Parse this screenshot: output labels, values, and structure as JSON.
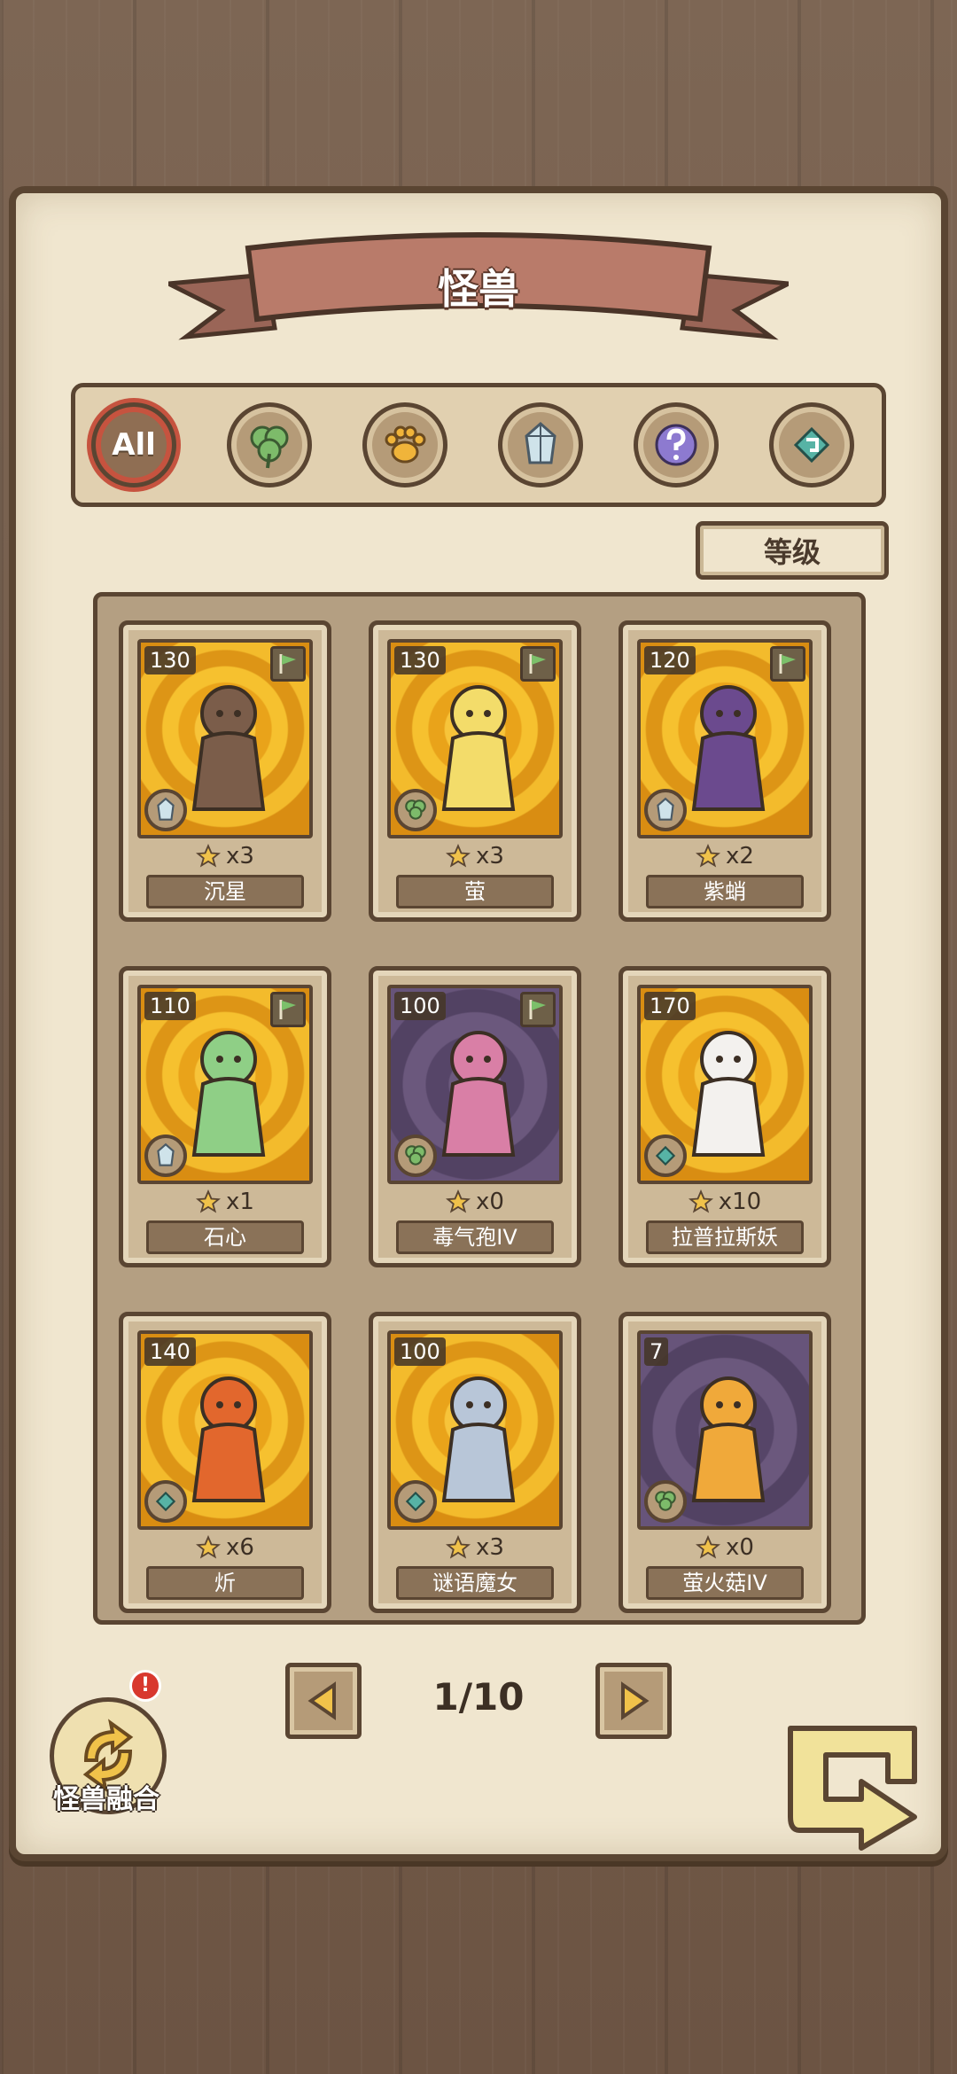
{
  "header": {
    "title": "怪兽"
  },
  "filters": [
    {
      "id": "all",
      "label": "All",
      "icon": "all-icon",
      "active": true
    },
    {
      "id": "plant",
      "icon": "clover-icon",
      "active": false
    },
    {
      "id": "beast",
      "icon": "paw-icon",
      "active": false
    },
    {
      "id": "crystal",
      "icon": "crystal-icon",
      "active": false
    },
    {
      "id": "unknown",
      "icon": "question-icon",
      "active": false
    },
    {
      "id": "mystic",
      "icon": "rune-icon",
      "active": false
    }
  ],
  "sort": {
    "label": "等级"
  },
  "monsters": [
    {
      "level": "130",
      "stars": "x3",
      "name": "沉星",
      "bg": "gold",
      "type": "crystal",
      "flag": true
    },
    {
      "level": "130",
      "stars": "x3",
      "name": "萤",
      "bg": "gold",
      "type": "plant",
      "flag": true
    },
    {
      "level": "120",
      "stars": "x2",
      "name": "紫蛸",
      "bg": "gold",
      "type": "crystal",
      "flag": true
    },
    {
      "level": "110",
      "stars": "x1",
      "name": "石心",
      "bg": "gold",
      "type": "crystal",
      "flag": true
    },
    {
      "level": "100",
      "stars": "x0",
      "name": "毒气孢IV",
      "bg": "purple",
      "type": "plant",
      "flag": true
    },
    {
      "level": "170",
      "stars": "x10",
      "name": "拉普拉斯妖",
      "bg": "gold",
      "type": "mystic",
      "flag": false
    },
    {
      "level": "140",
      "stars": "x6",
      "name": "炘",
      "bg": "gold",
      "type": "mystic",
      "flag": false
    },
    {
      "level": "100",
      "stars": "x3",
      "name": "谜语魔女",
      "bg": "gold",
      "type": "mystic",
      "flag": false
    },
    {
      "level": "7",
      "stars": "x0",
      "name": "萤火菇IV",
      "bg": "purple",
      "type": "plant",
      "flag": false
    }
  ],
  "pager": {
    "current": "1/10"
  },
  "fusion": {
    "label": "怪兽融合",
    "alert": "!"
  },
  "colors": {
    "wood": "#7d6654",
    "parchment": "#f0e6cf",
    "outline": "#5a4532",
    "banner": "#b97b6a",
    "gold_bg": "#f2b928",
    "purple_bg": "#5f4d72",
    "alert": "#d8382e"
  }
}
